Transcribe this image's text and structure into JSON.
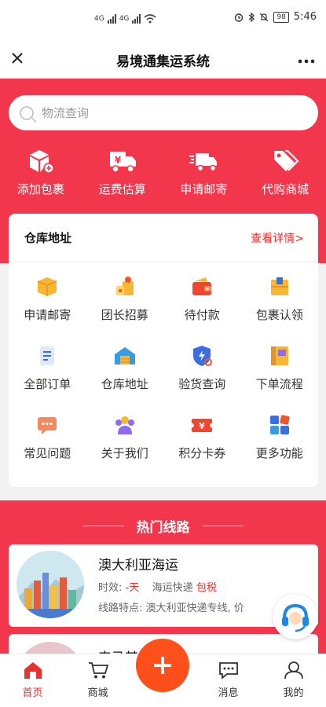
{
  "status_bar": {
    "network_left": "4G",
    "network_right": "4G",
    "battery": "98",
    "time": "5:46"
  },
  "header": {
    "title": "易境通集运系统",
    "close_icon": "close-icon",
    "more_icon": "more-icon"
  },
  "search": {
    "placeholder": "物流查询"
  },
  "quick_actions": [
    {
      "label": "添加包裹",
      "icon": "add-package-icon"
    },
    {
      "label": "运费估算",
      "icon": "freight-truck-icon"
    },
    {
      "label": "申请邮寄",
      "icon": "delivery-truck-icon"
    },
    {
      "label": "代购商城",
      "icon": "tags-icon"
    }
  ],
  "warehouse": {
    "title": "仓库地址",
    "link": "查看详情>"
  },
  "grid": [
    {
      "label": "申请邮寄",
      "icon": "package-icon"
    },
    {
      "label": "团长招募",
      "icon": "recruit-icon"
    },
    {
      "label": "待付款",
      "icon": "wallet-icon"
    },
    {
      "label": "包裹认领",
      "icon": "box-claim-icon"
    },
    {
      "label": "全部订单",
      "icon": "order-list-icon"
    },
    {
      "label": "仓库地址",
      "icon": "warehouse-icon"
    },
    {
      "label": "验货查询",
      "icon": "inspect-shield-icon"
    },
    {
      "label": "下单流程",
      "icon": "book-icon"
    },
    {
      "label": "常见问题",
      "icon": "chat-bubble-icon"
    },
    {
      "label": "关于我们",
      "icon": "team-icon"
    },
    {
      "label": "积分卡券",
      "icon": "coupon-icon"
    },
    {
      "label": "更多功能",
      "icon": "more-grid-icon"
    }
  ],
  "routes": {
    "title": "热门线路",
    "items": [
      {
        "name": "澳大利亚海运",
        "time_label": "时效:",
        "time_value": "-天",
        "channel": "海运快递",
        "tax": "包税",
        "feature": "线路特点: 澳大利亚快递专线, 价"
      },
      {
        "name": "韦马其"
      }
    ]
  },
  "tabbar": [
    {
      "label": "首页",
      "icon": "home-icon",
      "active": true
    },
    {
      "label": "商城",
      "icon": "cart-icon",
      "active": false
    },
    {
      "label": "",
      "icon": "plus-icon",
      "active": false
    },
    {
      "label": "消息",
      "icon": "message-icon",
      "active": false
    },
    {
      "label": "我的",
      "icon": "profile-icon",
      "active": false
    }
  ],
  "colors": {
    "brand_red": "#f2374d",
    "accent_orange": "#ff4f1a",
    "link_red": "#e8322f"
  }
}
